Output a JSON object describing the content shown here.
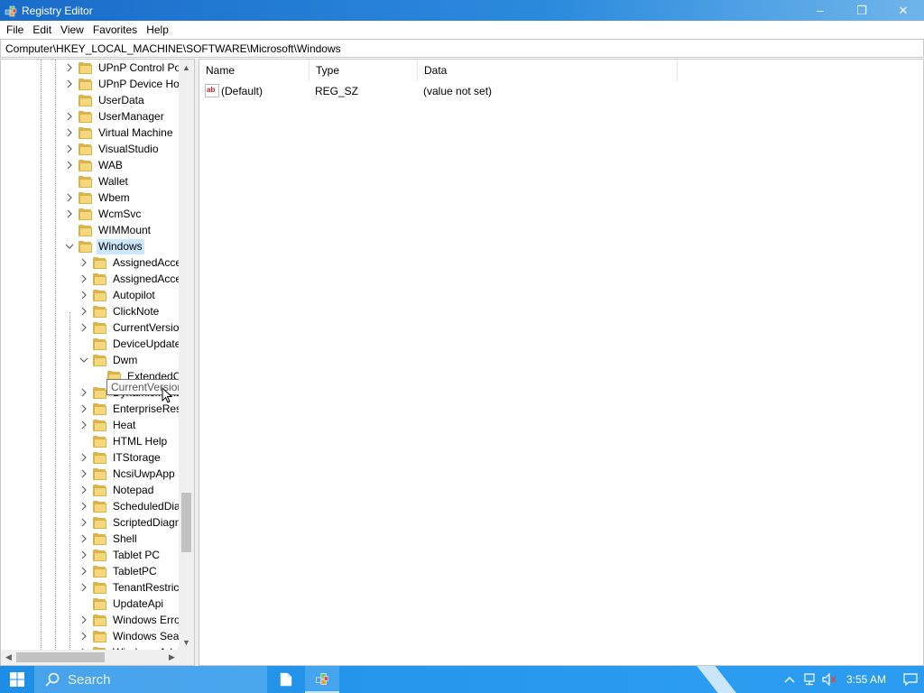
{
  "window": {
    "title": "Registry Editor",
    "minimize": "–",
    "maximize": "❐",
    "close": "✕"
  },
  "menu": [
    "File",
    "Edit",
    "View",
    "Favorites",
    "Help"
  ],
  "address": "Computer\\HKEY_LOCAL_MACHINE\\SOFTWARE\\Microsoft\\Windows",
  "tree": {
    "items": [
      {
        "label": "UPnP Control Poi",
        "expander": ">",
        "level": 0
      },
      {
        "label": "UPnP Device Hos",
        "expander": ">",
        "level": 0
      },
      {
        "label": "UserData",
        "expander": "",
        "level": 0
      },
      {
        "label": "UserManager",
        "expander": ">",
        "level": 0
      },
      {
        "label": "Virtual Machine",
        "expander": ">",
        "level": 0
      },
      {
        "label": "VisualStudio",
        "expander": ">",
        "level": 0
      },
      {
        "label": "WAB",
        "expander": ">",
        "level": 0
      },
      {
        "label": "Wallet",
        "expander": "",
        "level": 0
      },
      {
        "label": "Wbem",
        "expander": ">",
        "level": 0
      },
      {
        "label": "WcmSvc",
        "expander": ">",
        "level": 0
      },
      {
        "label": "WIMMount",
        "expander": "",
        "level": 0
      },
      {
        "label": "Windows",
        "expander": "v",
        "level": 0,
        "selected": true
      },
      {
        "label": "AssignedAcce",
        "expander": ">",
        "level": 1
      },
      {
        "label": "AssignedAcce",
        "expander": ">",
        "level": 1
      },
      {
        "label": "Autopilot",
        "expander": ">",
        "level": 1
      },
      {
        "label": "ClickNote",
        "expander": ">",
        "level": 1
      },
      {
        "label": "CurrentVersion",
        "expander": ">",
        "level": 1
      },
      {
        "label": "DeviceUpdate",
        "expander": "",
        "level": 1
      },
      {
        "label": "Dwm",
        "expander": "v",
        "level": 1
      },
      {
        "label": "ExtendedC",
        "expander": "",
        "level": 2
      },
      {
        "label": "DynamicMana",
        "expander": ">",
        "level": 1
      },
      {
        "label": "EnterpriseResc",
        "expander": ">",
        "level": 1
      },
      {
        "label": "Heat",
        "expander": ">",
        "level": 1
      },
      {
        "label": "HTML Help",
        "expander": "",
        "level": 1
      },
      {
        "label": "ITStorage",
        "expander": ">",
        "level": 1
      },
      {
        "label": "NcsiUwpApp",
        "expander": ">",
        "level": 1
      },
      {
        "label": "Notepad",
        "expander": ">",
        "level": 1
      },
      {
        "label": "ScheduledDiag",
        "expander": ">",
        "level": 1
      },
      {
        "label": "ScriptedDiagn",
        "expander": ">",
        "level": 1
      },
      {
        "label": "Shell",
        "expander": ">",
        "level": 1
      },
      {
        "label": "Tablet PC",
        "expander": ">",
        "level": 1
      },
      {
        "label": "TabletPC",
        "expander": ">",
        "level": 1
      },
      {
        "label": "TenantRestrict",
        "expander": ">",
        "level": 1
      },
      {
        "label": "UpdateApi",
        "expander": "",
        "level": 1
      },
      {
        "label": "Windows Error",
        "expander": ">",
        "level": 1
      },
      {
        "label": "Windows Sear",
        "expander": ">",
        "level": 1
      },
      {
        "label": "Windows Advi",
        "expander": ">",
        "level": 1
      }
    ],
    "tooltip": "CurrentVersion"
  },
  "values": {
    "columns": [
      "Name",
      "Type",
      "Data"
    ],
    "rows": [
      {
        "icon": "ab",
        "name": "(Default)",
        "type": "REG_SZ",
        "data": "(value not set)"
      }
    ]
  },
  "taskbar": {
    "search_placeholder": "Search",
    "clock": "3:55 AM"
  },
  "colors": {
    "titlebar": "#1a6cc9",
    "taskbar": "#1e8ee6",
    "selection": "#cce8ff",
    "folder": "#f5d77d"
  }
}
